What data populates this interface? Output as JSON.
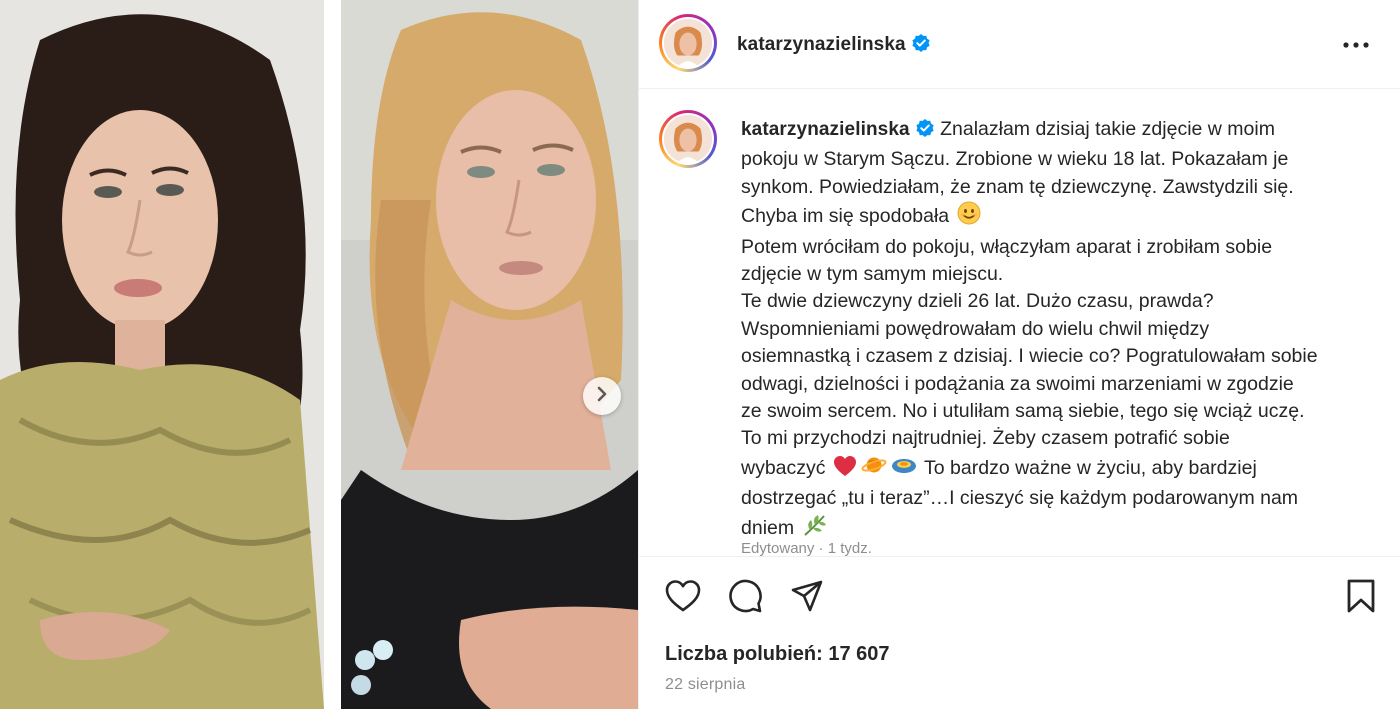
{
  "post": {
    "username": "katarzynazielinska",
    "verified": true,
    "caption_lines": [
      "Znalazłam dzisiaj takie zdjęcie w moim",
      "pokoju w Starym Sączu. Zrobione w wieku 18 lat. Pokazałam je",
      "synkom. Powiedziałam, że znam tę dziewczynę. Zawstydzili się.",
      "Chyba im się spodobała",
      "Potem wróciłam do pokoju, włączyłam aparat i zrobiłam sobie",
      "zdjęcie w tym samym miejscu.",
      "Te dwie dziewczyny dzieli 26 lat. Dużo czasu, prawda?",
      "Wspomnieniami powędrowałam do wielu chwil między",
      "osiemnastką i czasem z dzisiaj. I wiecie co? Pogratulowałam sobie",
      "odwagi, dzielności i podążania za swoimi marzeniami w zgodzie",
      "ze swoim sercem. No i utuliłam samą siebie, tego się wciąż uczę.",
      "To mi przychodzi najtrudniej. Żeby czasem potrafić sobie",
      "wybaczyć",
      "To bardzo ważne w życiu, aby bardziej",
      "dostrzegać „tu i teraz”…I cieszyć się każdym podarowanym nam",
      "dniem"
    ],
    "edit_meta": "Edytowany · 1 tydz.",
    "likes_label": "Liczba polubień: 17 607",
    "date": "22 sierpnia"
  },
  "icons": {
    "verified": "verified-badge-icon",
    "more": "more-options-icon",
    "like": "heart-icon",
    "comment": "comment-icon",
    "share": "send-icon",
    "save": "bookmark-icon",
    "next": "chevron-right-icon",
    "emoji_smile": "smiling-face-emoji",
    "emoji_heart": "red-heart-emoji",
    "emoji_planet": "ringed-planet-emoji",
    "emoji_disc": "flying-disc-emoji",
    "emoji_herb": "herb-emoji"
  },
  "colors": {
    "verified_blue": "#0095f6",
    "text": "#262626",
    "muted": "#8e8e8e",
    "divider": "#efefef"
  }
}
